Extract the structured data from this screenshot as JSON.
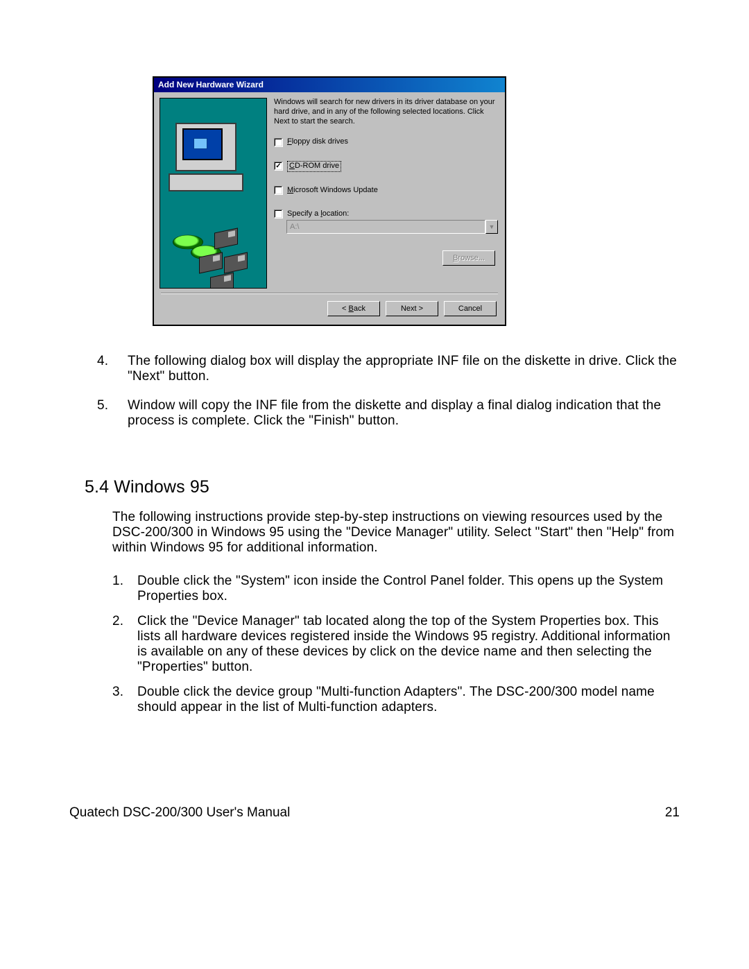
{
  "dialog": {
    "title": "Add New Hardware Wizard",
    "instruction": "Windows will search for new drivers in its driver database on your hard drive, and in any of the following selected locations. Click Next to start the search.",
    "check_floppy": {
      "label_pre": "",
      "label": "loppy disk drives",
      "mnemonic": "F",
      "checked": false
    },
    "check_cdrom": {
      "label_pre": "",
      "label": "D-ROM drive",
      "mnemonic": "C",
      "checked": true
    },
    "check_winupd": {
      "label_pre": "",
      "label": "icrosoft Windows Update",
      "mnemonic": "M",
      "checked": false
    },
    "check_loc": {
      "label": "Specify a ",
      "label_post": "ocation:",
      "mnemonic": "l",
      "checked": false
    },
    "location_value": "A:\\",
    "browse_label_pre": "B",
    "browse_label": "rowse...",
    "back_label_pre": "< ",
    "back_mnemonic": "B",
    "back_label": "ack",
    "next_label": "Next >",
    "cancel_label": "Cancel"
  },
  "steps_top": [
    {
      "num": "4.",
      "text": "The following dialog box will display the appropriate INF file on the diskette in drive. Click the \"Next\" button."
    },
    {
      "num": "5.",
      "text": "Window will copy the INF file from the diskette and display a final dialog indication that the process is complete. Click the \"Finish\" button."
    }
  ],
  "section": {
    "title": "5.4  Windows 95"
  },
  "section_intro": "The following instructions provide step-by-step instructions on viewing resources used by the DSC-200/300 in Windows 95 using the \"Device Manager\" utility.  Select \"Start\" then \"Help\" from within Windows 95 for additional information.",
  "sub_steps": [
    {
      "num": "1.",
      "text": "Double click the \"System\" icon inside the Control Panel folder.  This opens up the System Properties box."
    },
    {
      "num": "2.",
      "text": "Click the \"Device Manager\" tab located along the top of the System Properties box.  This lists all hardware devices registered inside the Windows 95 registry. Additional information is available on any of these devices by click on the device name and then selecting the \"Properties\" button."
    },
    {
      "num": "3.",
      "text": "Double click the device group \"Multi-function Adapters\".  The DSC-200/300 model name should appear in the list of Multi-function adapters."
    }
  ],
  "footer": {
    "left": "Quatech   DSC-200/300 User's Manual",
    "right": "21"
  }
}
